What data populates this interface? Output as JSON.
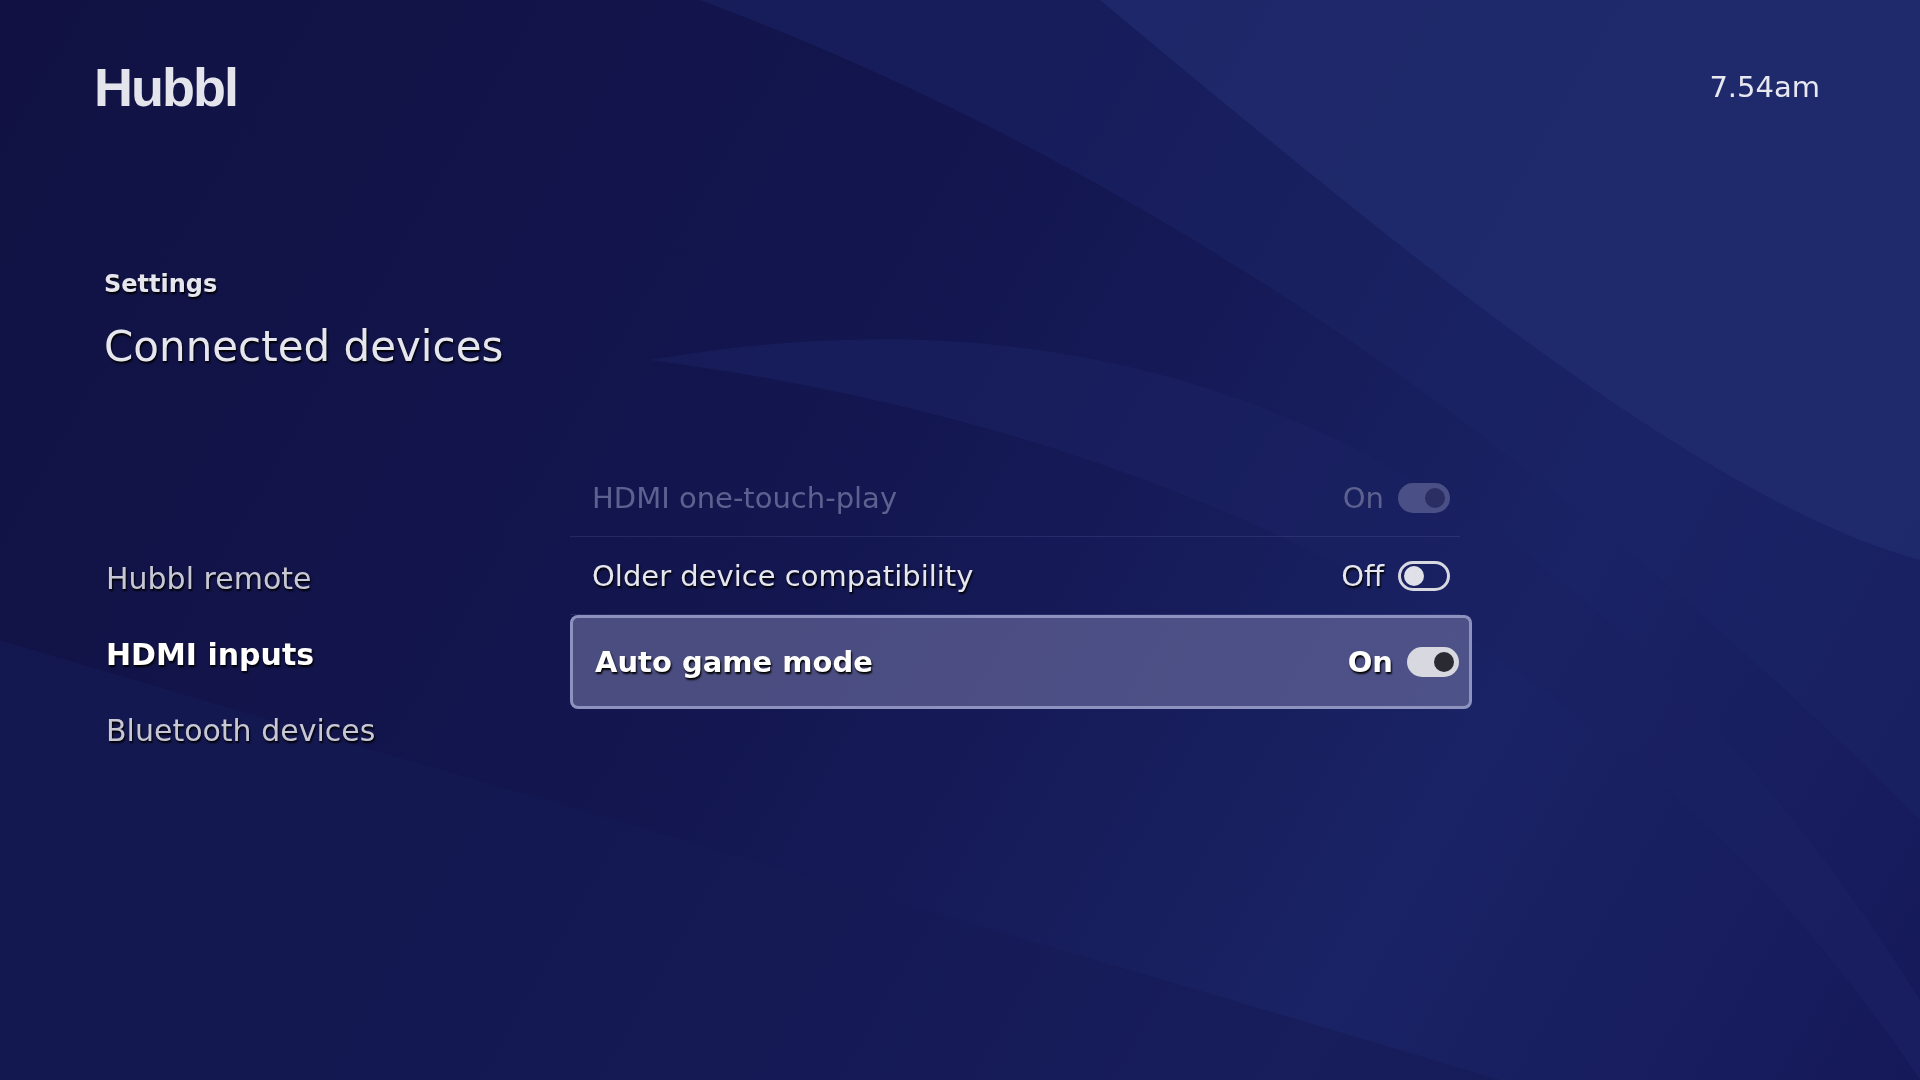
{
  "header": {
    "logo": "Hubbl",
    "time": "7.54am"
  },
  "breadcrumb": "Settings",
  "title": "Connected devices",
  "sidebar": {
    "items": [
      {
        "label": "Hubbl remote",
        "selected": false
      },
      {
        "label": "HDMI inputs",
        "selected": true
      },
      {
        "label": "Bluetooth devices",
        "selected": false
      }
    ]
  },
  "options": [
    {
      "label": "HDMI one-touch-play",
      "value": "On",
      "on": true,
      "disabled": true,
      "selected": false
    },
    {
      "label": "Older device compatibility",
      "value": "Off",
      "on": false,
      "disabled": false,
      "selected": false
    },
    {
      "label": "Auto game mode",
      "value": "On",
      "on": true,
      "disabled": false,
      "selected": true
    }
  ]
}
